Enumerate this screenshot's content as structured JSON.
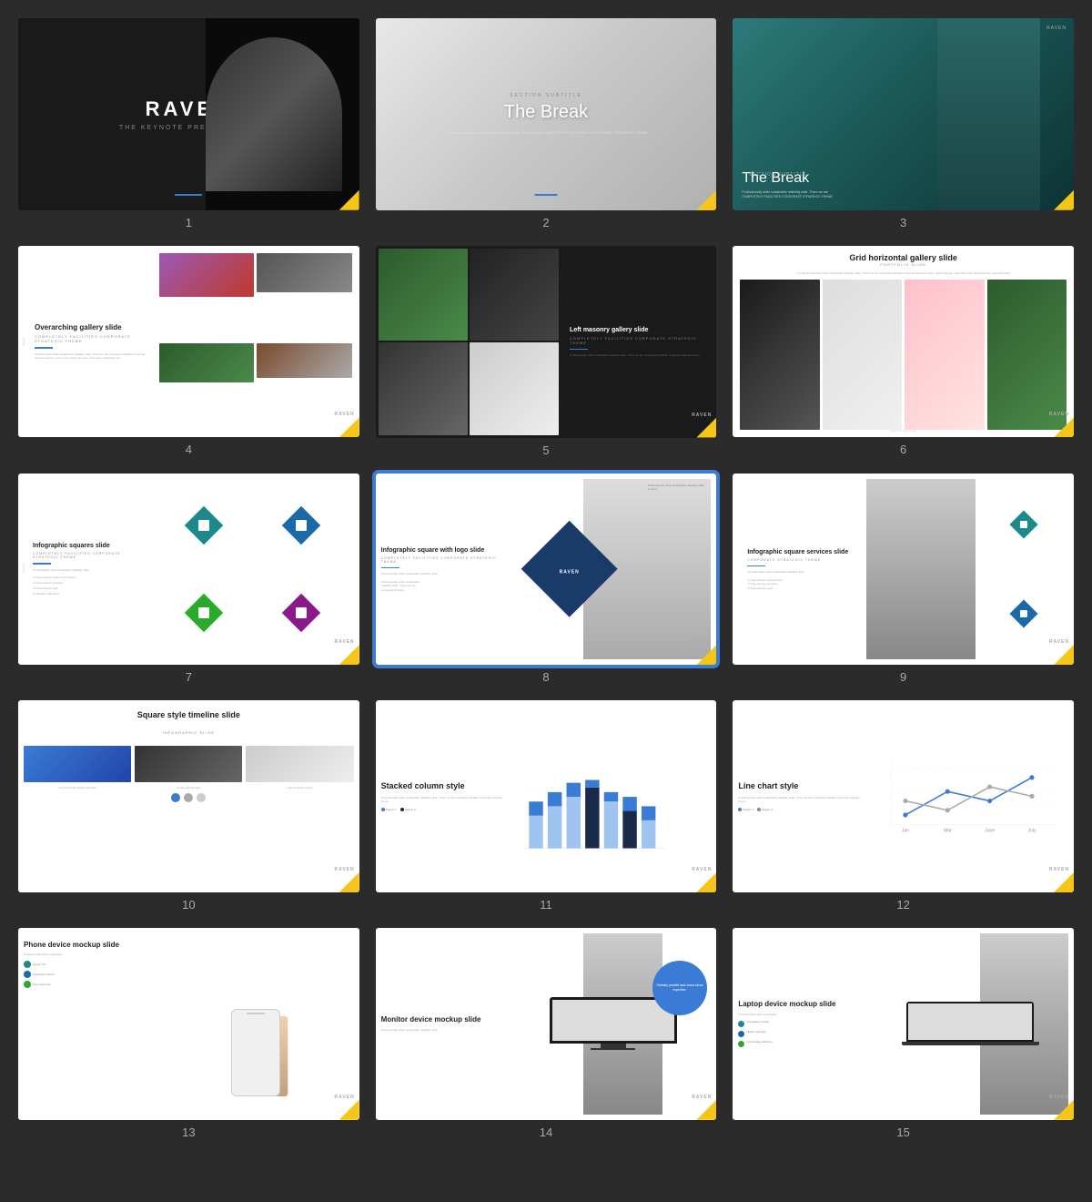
{
  "slides": [
    {
      "number": "1",
      "title": "RAVEN",
      "subtitle": "THE KEYNOTE PRESENTATION",
      "type": "dark-cover"
    },
    {
      "number": "2",
      "section": "SECTION SUBTITLE",
      "title": "The Break",
      "desc": "Professionally while sustainable reliability slide. There we are COMPLETELY FACILITIES CORPORATE STRATEGIC THEME",
      "type": "break-gray"
    },
    {
      "number": "3",
      "section": "SECTION SUBTITLE",
      "title": "The Break",
      "desc": "Professionally while sustainable reliability slide. There we are COMPLETELY FACILITIES CORPORATE STRATEGIC THEME",
      "type": "break-teal"
    },
    {
      "number": "4",
      "title": "Overarching gallery slide",
      "subtitle": "COMPLETELY FACILITIES CORPORATE STRATEGIC THEME",
      "desc": "Professionally while sustainable reliability slide. There we are completely facilities corporate strategic theme. Lorem ipsum dolor sit amet consectetur adipiscing elit.",
      "type": "gallery"
    },
    {
      "number": "5",
      "title": "Left masonry gallery slide",
      "subtitle": "COMPLETELY FACILITIES CORPORATE STRATEGIC THEME",
      "desc": "Professionally while sustainable reliability slide. There we are completely facilities corporate strategic theme.",
      "type": "masonry"
    },
    {
      "number": "6",
      "title": "Grid horizontal gallery slide",
      "subtitle": "PORTFOLIO SLIDE",
      "desc": "Completely describe while sustainable reliability slide. There we are completely facilities corporate strategic theme. Appreciatively, corporate while Appreciatively, corporate while",
      "type": "grid-horizontal"
    },
    {
      "number": "7",
      "title": "Infographic squares slide",
      "subtitle": "COMPLETELY FACILITIES CORPORATE STRATEGIC THEME",
      "desc": "Professionally while sustainable reliability slide.",
      "type": "infographic-squares"
    },
    {
      "number": "8",
      "title": "Infographic square with logo slide",
      "subtitle": "COMPLETELY FACILITIES CORPORATE STRATEGIC THEME",
      "desc": "Professionally while sustainable reliability slide.",
      "type": "infographic-logo",
      "active": true
    },
    {
      "number": "9",
      "title": "Infographic square services slide",
      "subtitle": "CORPORATE STRATEGIC THEME",
      "desc": "Professionally while sustainable reliability slide.",
      "type": "infographic-services"
    },
    {
      "number": "10",
      "title": "Square style timeline slide",
      "subtitle": "INFOGRAPHIC SLIDE",
      "labels": [
        "Astronomically deploy stenaule",
        "Continually iterative",
        "Harmoniously maybe"
      ],
      "type": "timeline"
    },
    {
      "number": "11",
      "title": "Stacked column style",
      "desc": "Professionally while sustainable reliability slide. There we are completely facilities corporate strategic theme.",
      "legend": [
        "Region 1",
        "Region 2"
      ],
      "type": "stacked-column"
    },
    {
      "number": "12",
      "title": "Line chart style",
      "desc": "Professionally while sustainable reliability slide. There we are completely facilities corporate strategic theme.",
      "legend": [
        "Region 1",
        "Region 2"
      ],
      "xLabels": [
        "Jan",
        "Mar",
        "June",
        "July"
      ],
      "type": "line-chart"
    },
    {
      "number": "13",
      "title": "Phone device mockup slide",
      "features": [
        "Layout Pro",
        "Immersed options",
        "Port customize"
      ],
      "type": "phone-mockup"
    },
    {
      "number": "14",
      "title": "Monitor device mockup slide",
      "circle_text": "Globally parallel task stand alone expertise.",
      "type": "monitor-mockup"
    },
    {
      "number": "15",
      "title": "Laptop device mockup slide",
      "features": [
        "Completely results",
        "Highly important",
        "Functionally delicious"
      ],
      "type": "laptop-mockup"
    }
  ],
  "brand": {
    "name": "RAVEN",
    "accent_blue": "#3a7bd5",
    "accent_yellow": "#f5c518",
    "accent_teal": "#1a8a8a"
  }
}
